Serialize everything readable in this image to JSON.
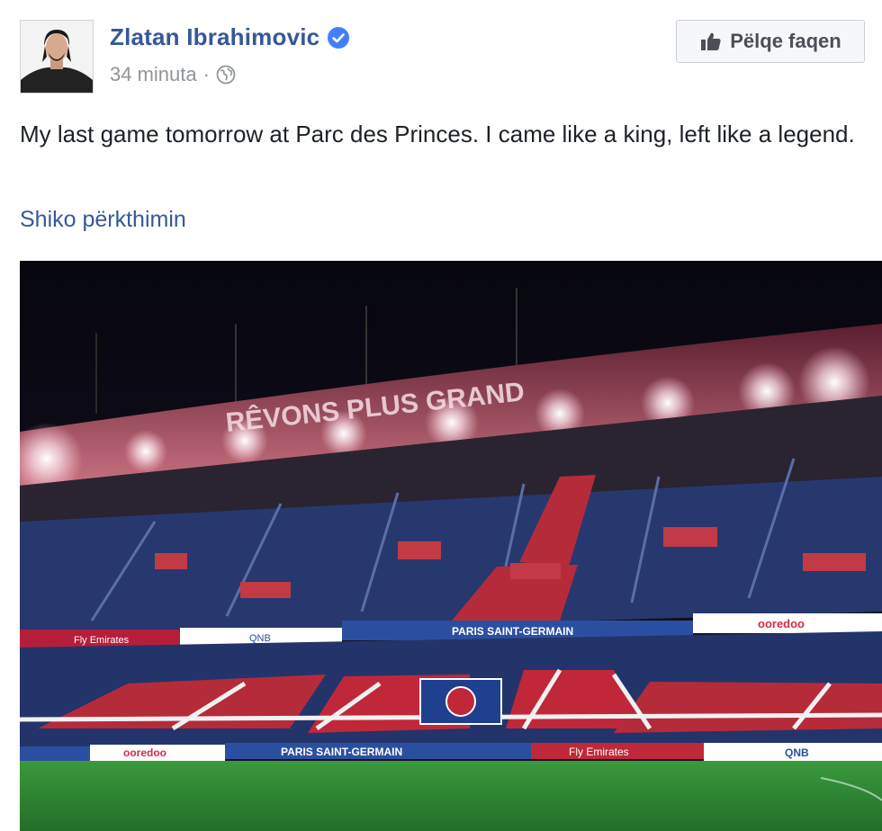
{
  "post": {
    "author": "Zlatan Ibrahimovic",
    "verified": true,
    "timestamp": "34 minuta",
    "separator": "·",
    "audience_icon": "globe-icon",
    "like_page_label": "Pëlqe faqen",
    "like_icon": "thumbs-up-icon",
    "text": "My last game tomorrow at Parc des Princes. I came like a king, left like a legend.",
    "see_translation": "Shiko përkthimin"
  },
  "photo": {
    "roof_banner": "RÊVONS PLUS GRAND",
    "ad_boards_upper": [
      "Fly Emirates",
      "QNB",
      "PARIS SAINT-GERMAIN",
      "ooredoo"
    ],
    "ad_boards_lower": [
      "ooredoo",
      "PARIS SAINT-GERMAIN",
      "Fly Emirates",
      "QNB"
    ],
    "colors": {
      "night_sky": "#0b0c18",
      "roof_band": "#7a2c3c",
      "seat_blue": "#2b3d7a",
      "seat_red": "#c0283a",
      "pitch_green": "#2f8a35"
    }
  },
  "colors": {
    "link": "#365899",
    "meta": "#90949c",
    "text": "#1d2129",
    "verified": "#4080ff"
  }
}
